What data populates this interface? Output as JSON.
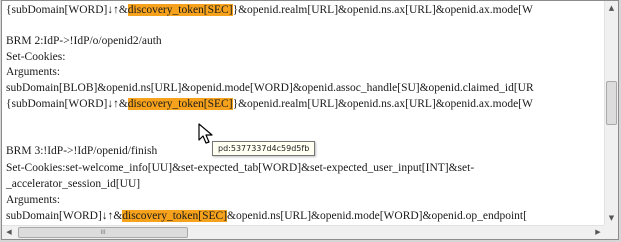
{
  "lines": [
    {
      "pre": "{subDomain[WORD]↓↑&",
      "hl": "discovery_token[SEC]",
      "post": "}&openid.realm[URL]&openid.ns.ax[URL]&openid.ax.mode[W"
    },
    {
      "text": "BRM 2:IdP->!IdP/o/openid2/auth"
    },
    {
      "text": "Set-Cookies:"
    },
    {
      "text": "Arguments:"
    },
    {
      "text": "subDomain[BLOB]&openid.ns[URL]&openid.mode[WORD]&openid.assoc_handle[SU]&openid.claimed_id[UR"
    },
    {
      "pre": "{subDomain[WORD]↓↑&",
      "hl": "discovery_token[SEC]",
      "post": "}&openid.realm[URL]&openid.ns.ax[URL]&openid.ax.mode[W"
    },
    {
      "text": "BRM 3:!IdP->!IdP/openid/finish"
    },
    {
      "text": "Set-Cookies:set-welcome_info[UU]&set-expected_tab[WORD]&set-expected_user_input[INT]&set-"
    },
    {
      "text": "_accelerator_session_id[UU]"
    },
    {
      "text": "Arguments:"
    },
    {
      "pre": "subDomain[WORD]↓↑&",
      "hl": "discovery_token[SEC]",
      "post": "&openid.ns[URL]&openid.mode[WORD]&openid.op_endpoint["
    }
  ],
  "tooltip": "pd:5377337d4c59d5fb",
  "scrollbar": {
    "up": "▲",
    "down": "▼",
    "left": "◀",
    "right": "▶",
    "grip": "III",
    "right_edge_mark": "≡"
  },
  "colors": {
    "highlight": "#f6a21c"
  },
  "icons": {
    "cursor": "arrow-cursor-icon"
  }
}
